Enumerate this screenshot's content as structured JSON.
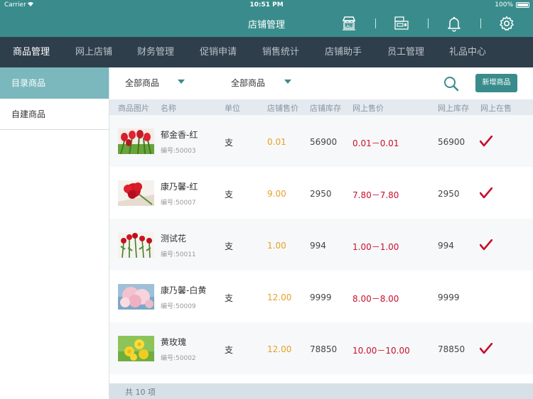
{
  "status_bar": {
    "carrier": "Carrier",
    "time": "10:51 PM",
    "battery": "100%"
  },
  "header": {
    "title": "店铺管理",
    "icons": [
      "sale-icon",
      "cash-register-icon",
      "bell-icon",
      "gear-icon"
    ]
  },
  "nav": [
    {
      "label": "商品管理",
      "active": true
    },
    {
      "label": "网上店铺"
    },
    {
      "label": "财务管理"
    },
    {
      "label": "促销申请"
    },
    {
      "label": "销售统计"
    },
    {
      "label": "店铺助手"
    },
    {
      "label": "员工管理"
    },
    {
      "label": "礼品中心"
    }
  ],
  "sidebar": {
    "items": [
      {
        "label": "目录商品",
        "active": true
      },
      {
        "label": "自建商品"
      }
    ]
  },
  "filters": {
    "category": "全部商品",
    "status": "全部商品",
    "add_label": "新增商品"
  },
  "table": {
    "headers": [
      "商品图片",
      "名称",
      "单位",
      "店铺售价",
      "店铺库存",
      "网上售价",
      "网上库存",
      "网上在售"
    ],
    "rows": [
      {
        "name": "郁金香-红",
        "code": "编号:50003",
        "unit": "支",
        "store_price": "0.01",
        "store_stock": "56900",
        "online_price": "0.01－0.01",
        "online_stock": "56900",
        "on_sale": true,
        "image": "red-tulips"
      },
      {
        "name": "康乃馨-红",
        "code": "编号:50007",
        "unit": "支",
        "store_price": "9.00",
        "store_stock": "2950",
        "online_price": "7.80－7.80",
        "online_stock": "2950",
        "on_sale": true,
        "image": "red-carnation"
      },
      {
        "name": "测试花",
        "code": "编号:50011",
        "unit": "支",
        "store_price": "1.00",
        "store_stock": "994",
        "online_price": "1.00－1.00",
        "online_stock": "994",
        "on_sale": true,
        "image": "red-roses"
      },
      {
        "name": "康乃馨-白黄",
        "code": "编号:50009",
        "unit": "支",
        "store_price": "12.00",
        "store_stock": "9999",
        "online_price": "8.00－8.00",
        "online_stock": "9999",
        "on_sale": false,
        "image": "pink-peony"
      },
      {
        "name": "黄玫瑰",
        "code": "编号:50002",
        "unit": "支",
        "store_price": "12.00",
        "store_stock": "78850",
        "online_price": "10.00－10.00",
        "online_stock": "78850",
        "on_sale": true,
        "image": "yellow-roses"
      }
    ]
  },
  "footer": {
    "total": "共 10 项"
  },
  "colors": {
    "teal": "#3a8c8c",
    "nav_bg": "#2f3e4b",
    "price_orange": "#e8a025",
    "price_red": "#c8102e",
    "check_red": "#c8102e"
  }
}
